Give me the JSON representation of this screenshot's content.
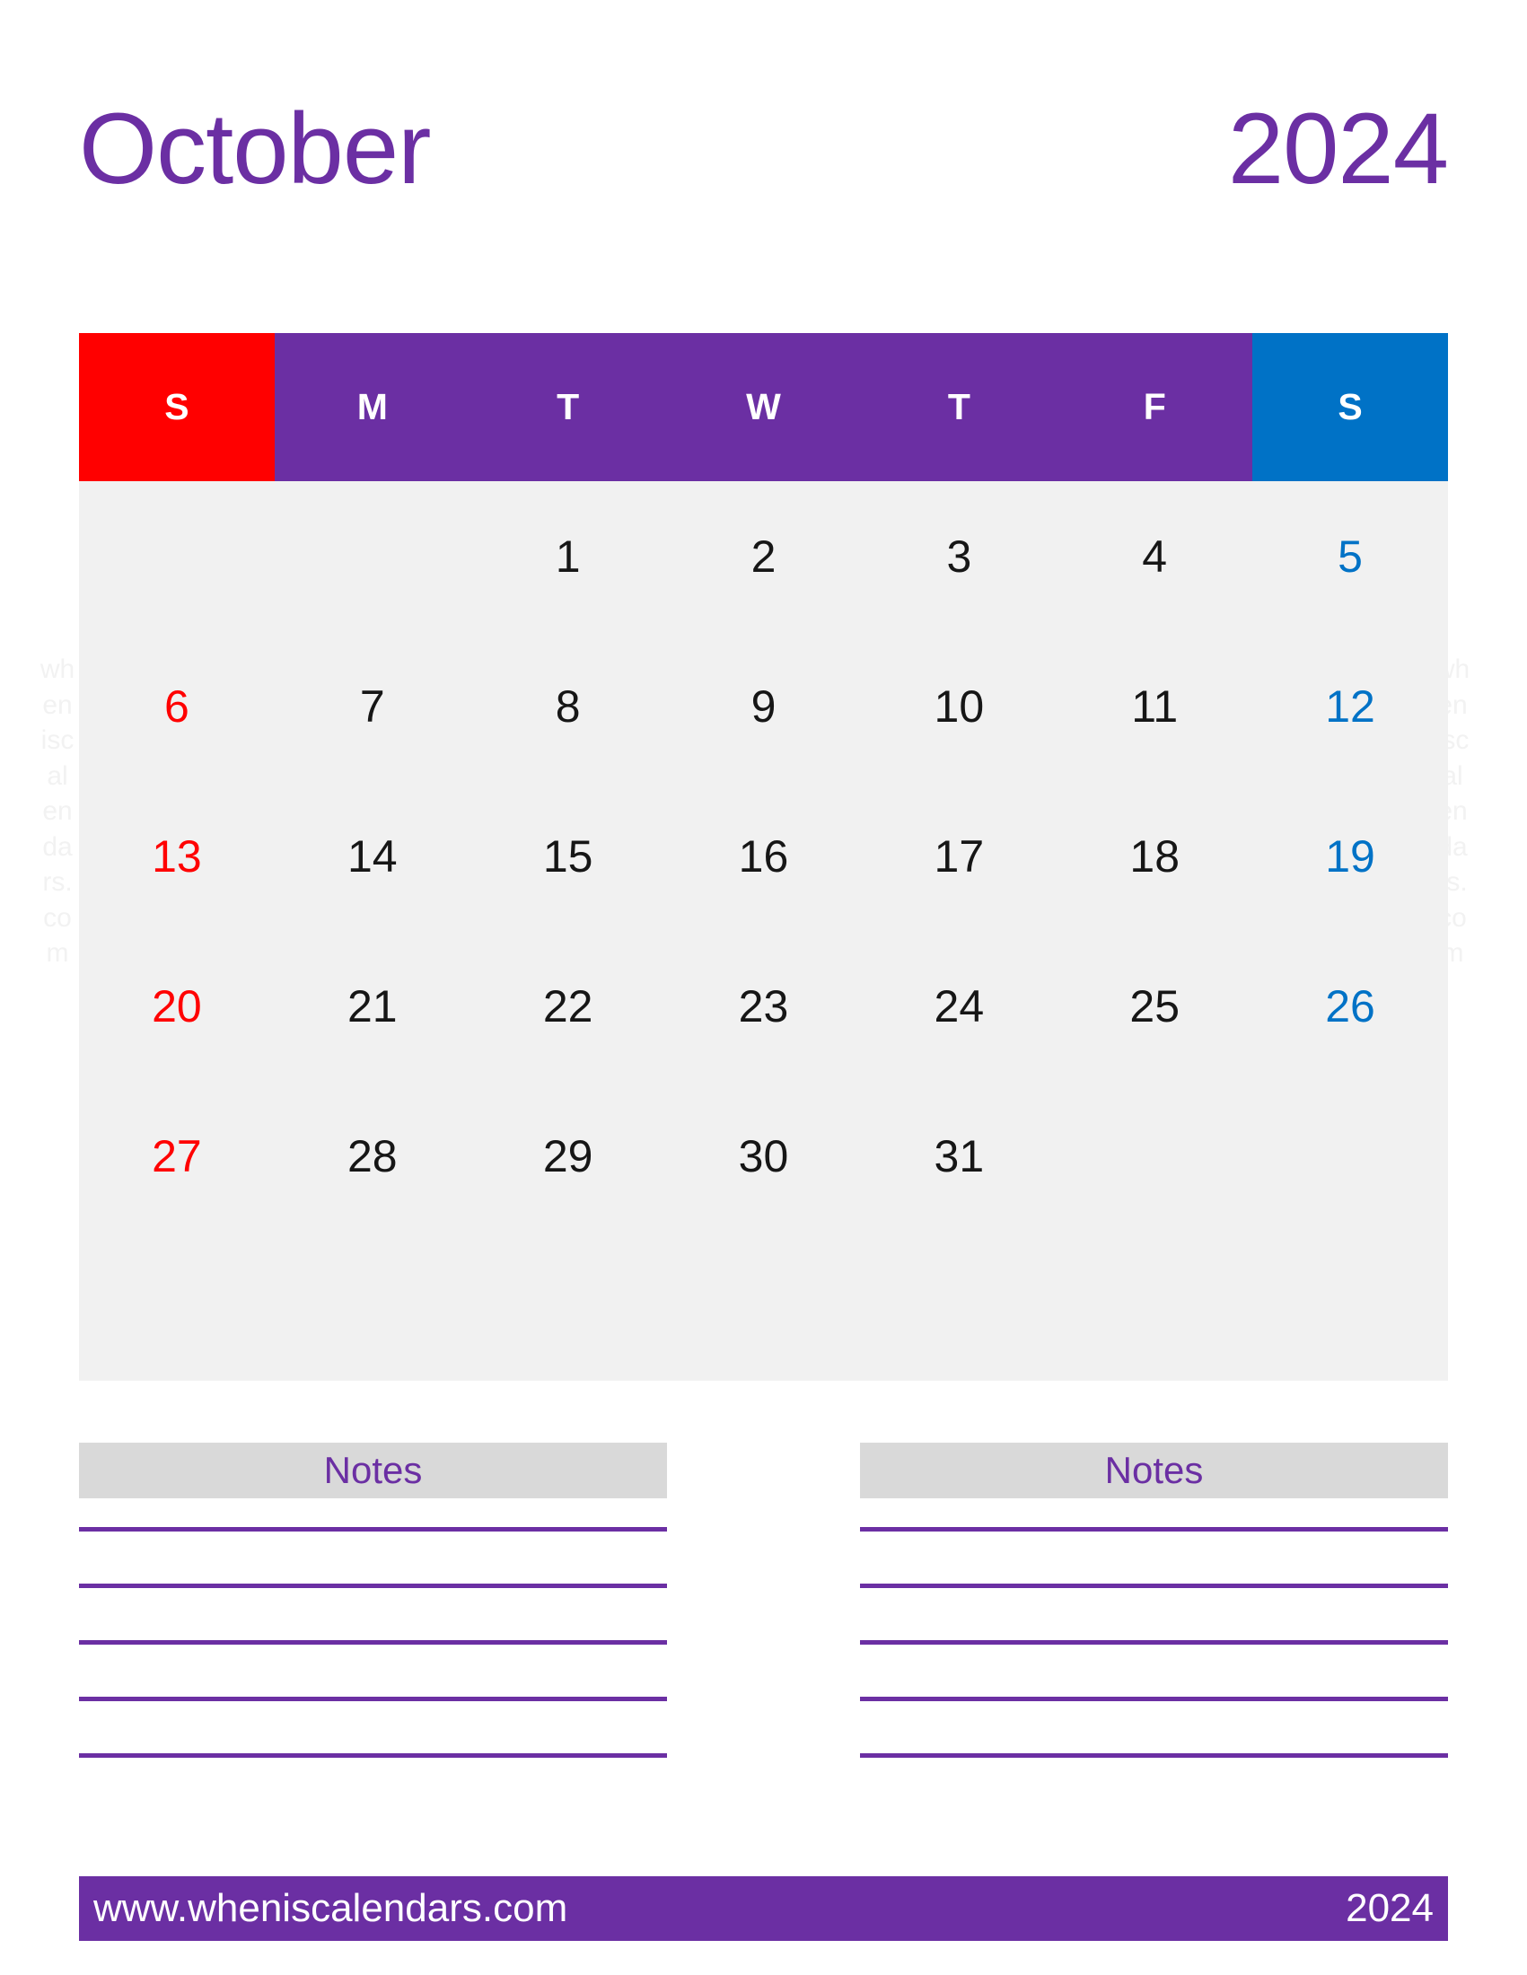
{
  "calendar": {
    "month": "October",
    "year": "2024",
    "weekdays": [
      {
        "label": "S",
        "kind": "sun"
      },
      {
        "label": "M",
        "kind": "weekday"
      },
      {
        "label": "T",
        "kind": "weekday"
      },
      {
        "label": "W",
        "kind": "weekday"
      },
      {
        "label": "T",
        "kind": "weekday"
      },
      {
        "label": "F",
        "kind": "weekday"
      },
      {
        "label": "S",
        "kind": "sat"
      }
    ],
    "weeks": [
      [
        {
          "day": "",
          "kind": "empty"
        },
        {
          "day": "",
          "kind": "empty"
        },
        {
          "day": "1",
          "kind": "weekday"
        },
        {
          "day": "2",
          "kind": "weekday"
        },
        {
          "day": "3",
          "kind": "weekday"
        },
        {
          "day": "4",
          "kind": "weekday"
        },
        {
          "day": "5",
          "kind": "sat"
        }
      ],
      [
        {
          "day": "6",
          "kind": "sun"
        },
        {
          "day": "7",
          "kind": "weekday"
        },
        {
          "day": "8",
          "kind": "weekday"
        },
        {
          "day": "9",
          "kind": "weekday"
        },
        {
          "day": "10",
          "kind": "weekday"
        },
        {
          "day": "11",
          "kind": "weekday"
        },
        {
          "day": "12",
          "kind": "sat"
        }
      ],
      [
        {
          "day": "13",
          "kind": "sun"
        },
        {
          "day": "14",
          "kind": "weekday"
        },
        {
          "day": "15",
          "kind": "weekday"
        },
        {
          "day": "16",
          "kind": "weekday"
        },
        {
          "day": "17",
          "kind": "weekday"
        },
        {
          "day": "18",
          "kind": "weekday"
        },
        {
          "day": "19",
          "kind": "sat"
        }
      ],
      [
        {
          "day": "20",
          "kind": "sun"
        },
        {
          "day": "21",
          "kind": "weekday"
        },
        {
          "day": "22",
          "kind": "weekday"
        },
        {
          "day": "23",
          "kind": "weekday"
        },
        {
          "day": "24",
          "kind": "weekday"
        },
        {
          "day": "25",
          "kind": "weekday"
        },
        {
          "day": "26",
          "kind": "sat"
        }
      ],
      [
        {
          "day": "27",
          "kind": "sun"
        },
        {
          "day": "28",
          "kind": "weekday"
        },
        {
          "day": "29",
          "kind": "weekday"
        },
        {
          "day": "30",
          "kind": "weekday"
        },
        {
          "day": "31",
          "kind": "weekday"
        },
        {
          "day": "",
          "kind": "empty"
        },
        {
          "day": "",
          "kind": "empty"
        }
      ],
      [
        {
          "day": "",
          "kind": "empty"
        },
        {
          "day": "",
          "kind": "empty"
        },
        {
          "day": "",
          "kind": "empty"
        },
        {
          "day": "",
          "kind": "empty"
        },
        {
          "day": "",
          "kind": "empty"
        },
        {
          "day": "",
          "kind": "empty"
        },
        {
          "day": "",
          "kind": "empty"
        }
      ]
    ]
  },
  "notes": {
    "left_title": "Notes",
    "right_title": "Notes",
    "line_count": 5
  },
  "footer": {
    "url": "www.wheniscalendars.com",
    "year": "2024"
  },
  "watermark": {
    "text": "wheniscalendars.com"
  },
  "colors": {
    "purple": "#6B2FA3",
    "red": "#FF0000",
    "blue": "#0072C6",
    "grid_background": "#F1F1F1",
    "notes_header_background": "#D9D9D9",
    "text_dark": "#161616",
    "white": "#FFFFFF"
  }
}
